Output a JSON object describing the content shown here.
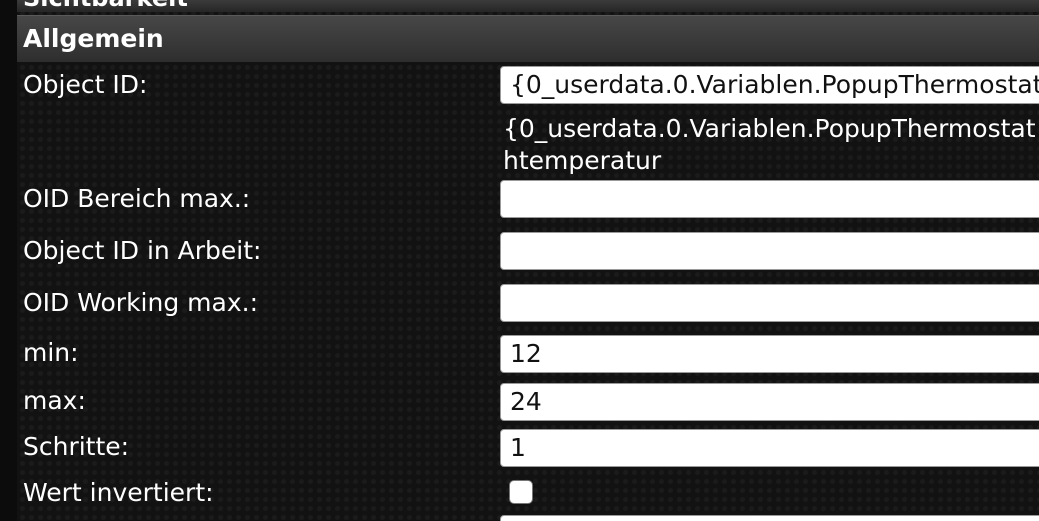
{
  "panel": {
    "previous_group_title": "Sichtbarkeit",
    "group_title": "Allgemein"
  },
  "fields": {
    "object_id": {
      "label": "Object ID:",
      "value": "{0_userdata.0.Variablen.PopupThermostat",
      "hint_line1": "{0_userdata.0.Variablen.PopupThermostat",
      "hint_line2": "htemperatur"
    },
    "oid_range_max": {
      "label": "OID Bereich max.:",
      "value": ""
    },
    "object_id_working": {
      "label": "Object ID in Arbeit:",
      "value": ""
    },
    "oid_working_max": {
      "label": "OID Working max.:",
      "value": ""
    },
    "min": {
      "label": "min:",
      "value": "12"
    },
    "max": {
      "label": "max:",
      "value": "24"
    },
    "steps": {
      "label": "Schritte:",
      "value": "1"
    },
    "value_inverted": {
      "label": "Wert invertiert:",
      "checked": false
    }
  }
}
